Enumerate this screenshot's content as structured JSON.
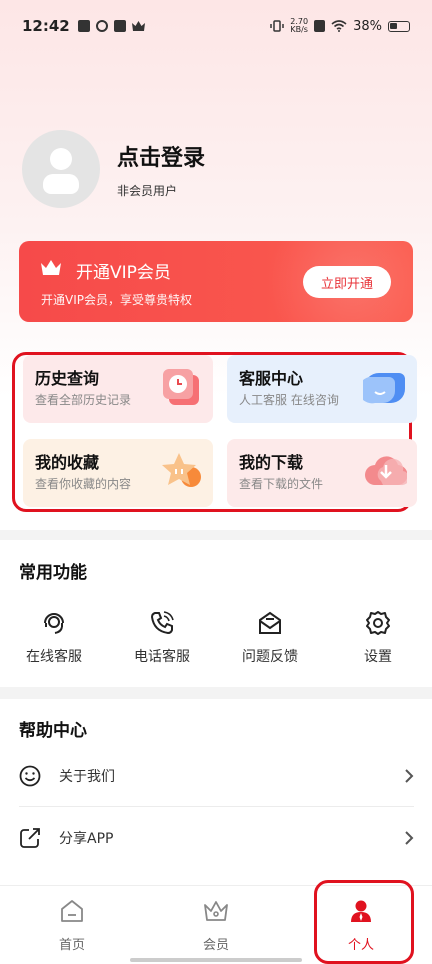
{
  "status_bar": {
    "time": "12:42",
    "net_speed_value": "2.70",
    "net_speed_unit": "KB/s",
    "battery": "38%"
  },
  "profile": {
    "login_text": "点击登录",
    "member_type": "非会员用户"
  },
  "vip": {
    "title": "开通VIP会员",
    "subtitle": "开通VIP会员，享受尊贵特权",
    "button_label": "立即开通",
    "color": "#f64a4a"
  },
  "features": [
    {
      "title": "历史查询",
      "subtitle": "查看全部历史记录",
      "icon": "history-clock-icon"
    },
    {
      "title": "客服中心",
      "subtitle": "人工客服 在线咨询",
      "icon": "chat-bubble-icon"
    },
    {
      "title": "我的收藏",
      "subtitle": "查看你收藏的内容",
      "icon": "star-icon"
    },
    {
      "title": "我的下载",
      "subtitle": "查看下载的文件",
      "icon": "cloud-download-icon"
    }
  ],
  "common": {
    "title": "常用功能",
    "items": [
      {
        "label": "在线客服",
        "icon": "headset-icon"
      },
      {
        "label": "电话客服",
        "icon": "phone-icon"
      },
      {
        "label": "问题反馈",
        "icon": "mail-feedback-icon"
      },
      {
        "label": "设置",
        "icon": "gear-icon"
      }
    ]
  },
  "help": {
    "title": "帮助中心",
    "items": [
      {
        "label": "关于我们",
        "icon": "smile-icon"
      },
      {
        "label": "分享APP",
        "icon": "share-icon"
      }
    ]
  },
  "tabbar": {
    "items": [
      {
        "label": "首页",
        "icon": "home-icon"
      },
      {
        "label": "会员",
        "icon": "crown-icon"
      },
      {
        "label": "个人",
        "icon": "person-icon",
        "active": true
      }
    ],
    "active_color": "#e0121f"
  }
}
